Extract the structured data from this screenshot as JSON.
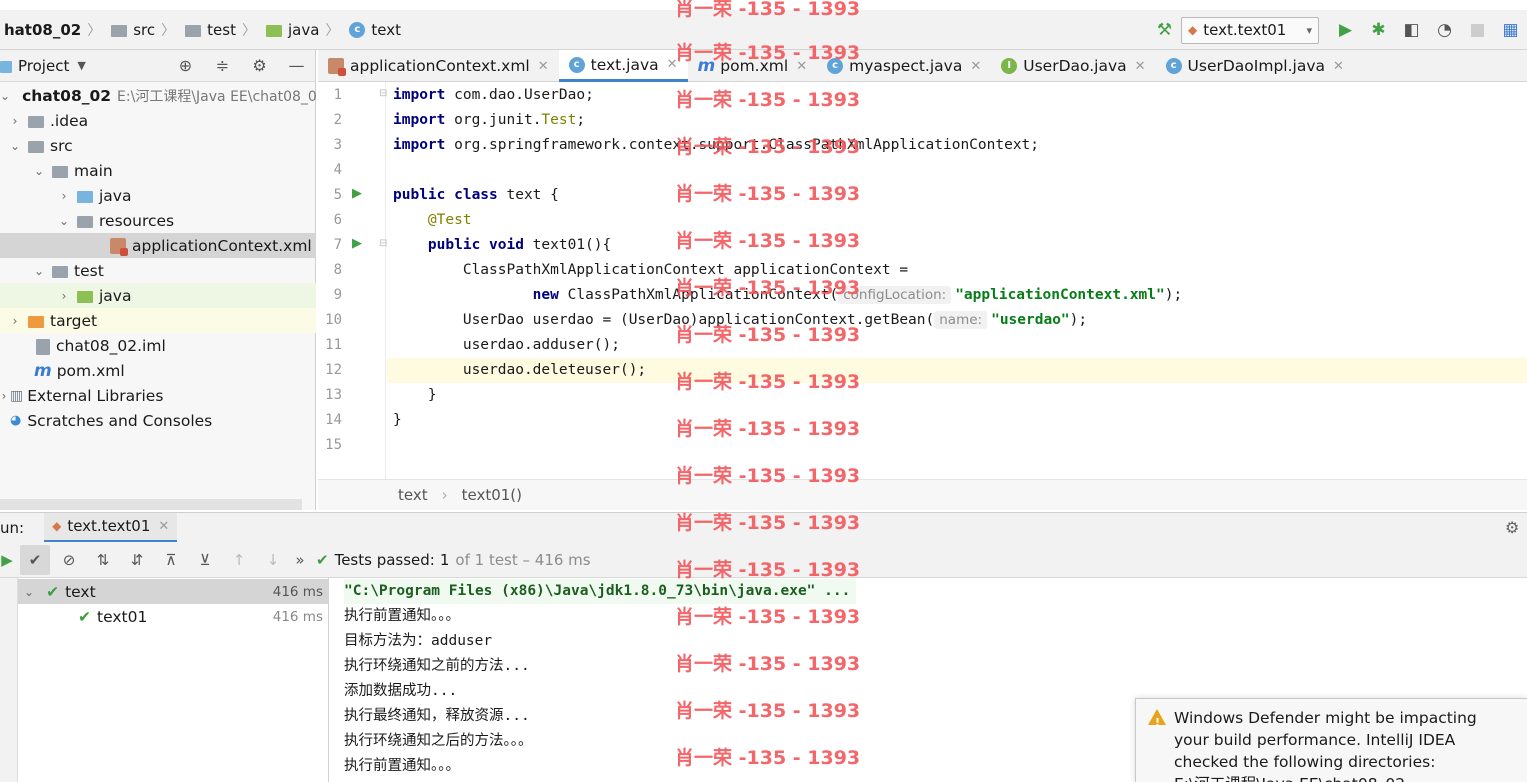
{
  "colors": {
    "accent": "#4083c9",
    "run_green": "#43a047",
    "watermark": "#f2565a",
    "warning": "#e8a21b"
  },
  "breadcrumb": [
    {
      "label": "hat08_02",
      "icon": "module-icon"
    },
    {
      "label": "src",
      "icon": "folder-icon"
    },
    {
      "label": "test",
      "icon": "folder-icon"
    },
    {
      "label": "java",
      "icon": "test-folder-icon"
    },
    {
      "label": "text",
      "icon": "class-icon"
    }
  ],
  "run_config": {
    "label": "text.text01"
  },
  "project_panel": {
    "title": "Project",
    "tree": [
      {
        "label": "chat08_02",
        "path": "E:\\河工课程\\Java EE\\chat08_0",
        "icon": "module-icon",
        "indent": 0,
        "arrow": "down"
      },
      {
        "label": ".idea",
        "icon": "folder-icon",
        "indent": 1,
        "arrow": "right"
      },
      {
        "label": "src",
        "icon": "folder-icon",
        "indent": 1,
        "arrow": "down"
      },
      {
        "label": "main",
        "icon": "folder-icon",
        "indent": 2,
        "arrow": "down"
      },
      {
        "label": "java",
        "icon": "source-folder-icon",
        "indent": 3,
        "arrow": "right"
      },
      {
        "label": "resources",
        "icon": "resources-folder-icon",
        "indent": 3,
        "arrow": "down"
      },
      {
        "label": "applicationContext.xml",
        "icon": "xml-file-icon",
        "indent": 4,
        "arrow": ""
      },
      {
        "label": "test",
        "icon": "folder-icon",
        "indent": 2,
        "arrow": "down"
      },
      {
        "label": "java",
        "icon": "test-folder-icon",
        "indent": 3,
        "arrow": "right"
      },
      {
        "label": "target",
        "icon": "excluded-folder-icon",
        "indent": 1,
        "arrow": "right"
      },
      {
        "label": "chat08_02.iml",
        "icon": "iml-file-icon",
        "indent": 1,
        "arrow": ""
      },
      {
        "label": "pom.xml",
        "icon": "maven-file-icon",
        "indent": 1,
        "arrow": ""
      },
      {
        "label": "External Libraries",
        "icon": "libraries-icon",
        "indent": 0,
        "arrow": "right"
      },
      {
        "label": "Scratches and Consoles",
        "icon": "scratches-icon",
        "indent": 0,
        "arrow": ""
      }
    ]
  },
  "editor_tabs": [
    {
      "label": "applicationContext.xml",
      "icon": "xml",
      "active": false
    },
    {
      "label": "text.java",
      "icon": "class",
      "active": true
    },
    {
      "label": "pom.xml",
      "icon": "maven",
      "active": false
    },
    {
      "label": "myaspect.java",
      "icon": "class",
      "active": false
    },
    {
      "label": "UserDao.java",
      "icon": "iface",
      "active": false
    },
    {
      "label": "UserDaoImpl.java",
      "icon": "class",
      "active": false
    }
  ],
  "code": {
    "line_numbers": [
      "1",
      "2",
      "3",
      "4",
      "5",
      "6",
      "7",
      "8",
      "9",
      "10",
      "11",
      "12",
      "13",
      "14",
      "15"
    ],
    "lines": {
      "l1_kw": "import",
      "l1_rest": " com.dao.UserDao;",
      "l2_kw": "import",
      "l2_a": " org.junit.",
      "l2_ann": "Test",
      "l2_b": ";",
      "l3_kw": "import",
      "l3_rest": " org.springframework.context.support.ClassPathXmlApplicationContext;",
      "l5_kw": "public class",
      "l5_rest": " text {",
      "l6_ann": "    @Test",
      "l7_kw": "    public void",
      "l7_rest": " text01(){",
      "l8": "        ClassPathXmlApplicationContext applicationContext =",
      "l9_kw": "                new",
      "l9_a": " ClassPathXmlApplicationContext(",
      "l9_hint": "configLocation:",
      "l9_str": "\"applicationContext.xml\"",
      "l9_b": ");",
      "l10_a": "        UserDao userdao = (UserDao)applicationContext.getBean(",
      "l10_hint": "name:",
      "l10_str": "\"userdao\"",
      "l10_b": ");",
      "l11": "        userdao.adduser();",
      "l12": "        userdao.deleteuser();",
      "l13": "    }",
      "l14": "}"
    }
  },
  "editor_breadcrumb": {
    "class": "text",
    "method": "text01()"
  },
  "run_panel": {
    "label": "un:",
    "tab": "text.text01",
    "status_label": "Tests passed:",
    "status_count": "1",
    "status_rest": "of 1 test – 416 ms",
    "tests": [
      {
        "label": "text",
        "time": "416 ms"
      },
      {
        "label": "text01",
        "time": "416 ms"
      }
    ],
    "console": [
      "\"C:\\Program Files (x86)\\Java\\jdk1.8.0_73\\bin\\java.exe\" ...",
      "执行前置通知。。。",
      "目标方法为：adduser",
      "执行环绕通知之前的方法...",
      "添加数据成功...",
      "执行最终通知，释放资源...",
      "执行环绕通知之后的方法。。。",
      "执行前置通知。。。"
    ]
  },
  "watermark": "肖一荣 -135 - 1393",
  "notification": {
    "text": "Windows Defender might be impacting your build performance. IntelliJ IDEA checked the following directories:",
    "path": "E:\\河工课程\\Java EE\\chat08_02"
  }
}
